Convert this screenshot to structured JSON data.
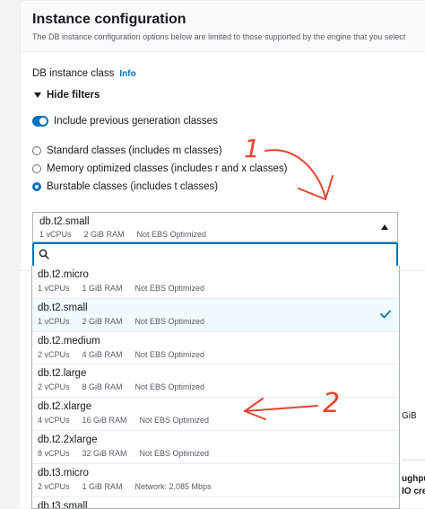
{
  "panel": {
    "title": "Instance configuration",
    "subtitle": "The DB instance configuration options below are limited to those supported by the engine that you select",
    "class_label": "DB instance class",
    "info_link": "Info",
    "hide_filters": "Hide filters",
    "toggle_label": "Include previous generation classes",
    "toggle_on": true,
    "radios": [
      {
        "label": "Standard classes (includes m classes)",
        "checked": false
      },
      {
        "label": "Memory optimized classes (includes r and x classes)",
        "checked": false
      },
      {
        "label": "Burstable classes (includes t classes)",
        "checked": true
      }
    ]
  },
  "select": {
    "value": "db.t2.small",
    "desc": [
      "1 vCPUs",
      "2 GiB RAM",
      "Not EBS Optimized"
    ],
    "search_placeholder": ""
  },
  "options": [
    {
      "name": "db.t2.micro",
      "desc": [
        "1 vCPUs",
        "1 GiB RAM",
        "Not EBS Optimized"
      ]
    },
    {
      "name": "db.t2.small",
      "desc": [
        "1 vCPUs",
        "2 GiB RAM",
        "Not EBS Optimized"
      ],
      "selected": true
    },
    {
      "name": "db.t2.medium",
      "desc": [
        "2 vCPUs",
        "4 GiB RAM",
        "Not EBS Optimized"
      ]
    },
    {
      "name": "db.t2.large",
      "desc": [
        "2 vCPUs",
        "8 GiB RAM",
        "Not EBS Optimized"
      ]
    },
    {
      "name": "db.t2.xlarge",
      "desc": [
        "4 vCPUs",
        "16 GiB RAM",
        "Not EBS Optimized"
      ]
    },
    {
      "name": "db.t2.2xlarge",
      "desc": [
        "8 vCPUs",
        "32 GiB RAM",
        "Not EBS Optimized"
      ]
    },
    {
      "name": "db.t3.micro",
      "desc": [
        "2 vCPUs",
        "1 GiB RAM",
        "Network: 2,085 Mbps"
      ]
    },
    {
      "name": "db.t3.small",
      "desc": []
    }
  ],
  "background": {
    "gib_fragment": "GiB",
    "throughput_fragment": "ughpu",
    "io_fragment": "IO cre"
  },
  "annotations": {
    "arrow1_label": "1",
    "arrow2_label": "2",
    "color": "#e8432e"
  },
  "colors": {
    "accent": "#0073bb",
    "selected_bg": "#f1faff"
  }
}
